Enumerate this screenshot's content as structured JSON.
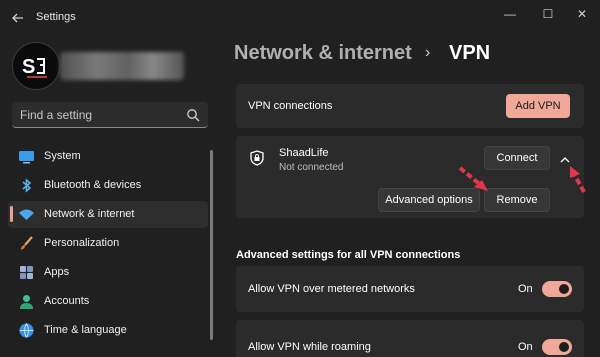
{
  "window": {
    "title": "Settings",
    "controls": {
      "minimize": "—",
      "maximize": "☐",
      "close": "✕"
    }
  },
  "search": {
    "placeholder": "Find a setting"
  },
  "sidebar": {
    "items": [
      {
        "label": "System",
        "icon": "monitor-icon"
      },
      {
        "label": "Bluetooth & devices",
        "icon": "bluetooth-icon"
      },
      {
        "label": "Network & internet",
        "icon": "wifi-icon",
        "selected": true
      },
      {
        "label": "Personalization",
        "icon": "brush-icon"
      },
      {
        "label": "Apps",
        "icon": "apps-icon"
      },
      {
        "label": "Accounts",
        "icon": "person-icon"
      },
      {
        "label": "Time & language",
        "icon": "globe-icon"
      }
    ]
  },
  "header": {
    "breadcrumb_parent": "Network & internet",
    "separator": "›",
    "current": "VPN"
  },
  "vpn_connections": {
    "title": "VPN connections",
    "add_button": "Add VPN"
  },
  "vpn_entry": {
    "name": "ShaadLife",
    "status": "Not connected",
    "connect_button": "Connect",
    "advanced_button": "Advanced options",
    "remove_button": "Remove"
  },
  "advanced": {
    "heading": "Advanced settings for all VPN connections",
    "settings": [
      {
        "label": "Allow VPN over metered networks",
        "state": "On"
      },
      {
        "label": "Allow VPN while roaming",
        "state": "On"
      }
    ]
  },
  "colors": {
    "accent": "#f0a898",
    "background": "#202020",
    "card": "#2b2b2b",
    "annotation_arrow": "#e0384a"
  }
}
